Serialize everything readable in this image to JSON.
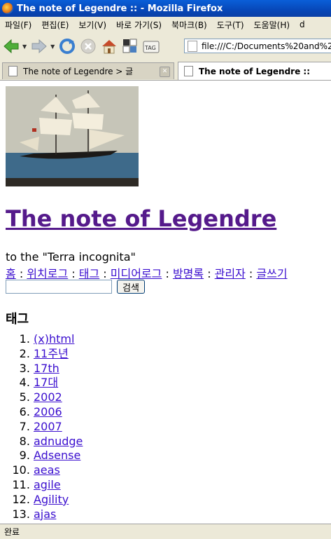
{
  "window": {
    "title": "The note of Legendre :: - Mozilla Firefox"
  },
  "menu": [
    "파일(F)",
    "편집(E)",
    "보기(V)",
    "바로 가기(S)",
    "북마크(B)",
    "도구(T)",
    "도움말(H)",
    "d"
  ],
  "toolbar": {
    "address": "file:///C:/Documents%20and%20",
    "icons": [
      "back-icon",
      "forward-icon",
      "reload-icon",
      "stop-icon",
      "home-icon",
      "tag-icon"
    ],
    "tag_label": "TAG"
  },
  "tabs": [
    {
      "label": "The note of Legendre > 글",
      "active": false
    },
    {
      "label": "The note of Legendre ::",
      "active": true
    }
  ],
  "page": {
    "title": "The note of Legendre",
    "description": "to the \"Terra incognita\"",
    "nav": [
      "홈",
      "위치로그",
      "태그",
      "미디어로그",
      "방명록",
      "관리자",
      "글쓰기"
    ],
    "nav_separator": " : ",
    "search_button": "검색",
    "search_value": "",
    "tags_heading": "태그",
    "tags": [
      "(x)html",
      "11주년",
      "17th",
      "17대",
      "2002",
      "2006",
      "2007",
      "adnudge",
      "Adsense",
      "aeas",
      "agile",
      "Agility",
      "ajas"
    ]
  },
  "status": {
    "text": "완료"
  }
}
